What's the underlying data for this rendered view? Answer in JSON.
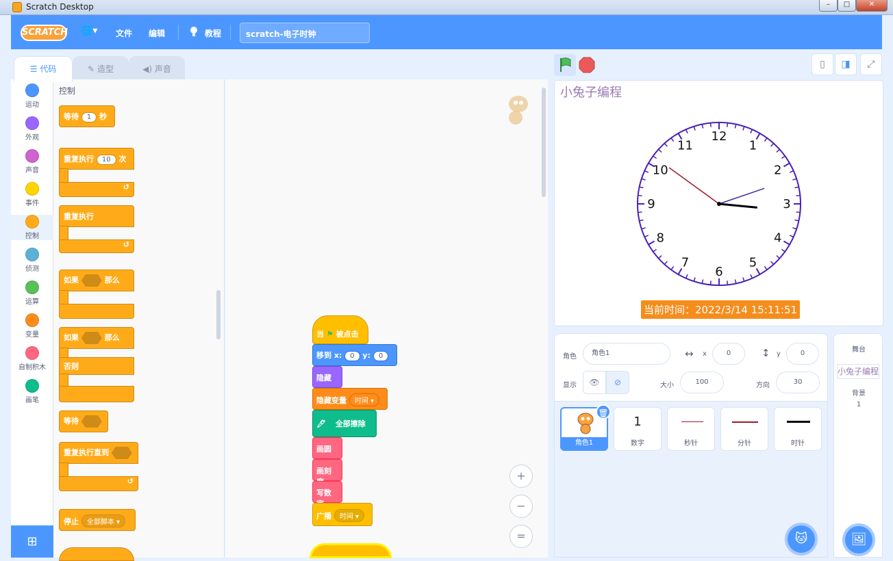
{
  "window": {
    "title": "Scratch Desktop",
    "minimize": "–",
    "maximize": "□",
    "close": "✕"
  },
  "menubar": {
    "logo": "SCRATCH",
    "globe": "🌐▾",
    "file": "文件",
    "edit": "编辑",
    "tutorials": "教程",
    "project_title": "scratch-电子时钟"
  },
  "tabs": {
    "code": "代码",
    "costumes": "造型",
    "sounds": "声音"
  },
  "categories": [
    {
      "label": "运动",
      "color": "#4c97ff"
    },
    {
      "label": "外观",
      "color": "#9966ff"
    },
    {
      "label": "声音",
      "color": "#cf63cf"
    },
    {
      "label": "事件",
      "color": "#ffd500"
    },
    {
      "label": "控制",
      "color": "#ffab19"
    },
    {
      "label": "侦测",
      "color": "#5cb1d6"
    },
    {
      "label": "运算",
      "color": "#59c059"
    },
    {
      "label": "变量",
      "color": "#ff8c1a"
    },
    {
      "label": "自制积木",
      "color": "#ff6680"
    },
    {
      "label": "画笔",
      "color": "#0fbd8c"
    }
  ],
  "palette": {
    "heading": "控制",
    "wait": "等待",
    "wait_value": "1",
    "wait_unit": "秒",
    "repeat": "重复执行",
    "repeat_value": "10",
    "repeat_unit": "次",
    "forever": "重复执行",
    "if": "如果",
    "then": "那么",
    "if2": "如果",
    "then2": "那么",
    "else": "否则",
    "wait_until": "等待",
    "repeat_until": "重复执行直到",
    "stop": "停止",
    "stop_option": "全部脚本 ▾"
  },
  "script": {
    "hat": "当",
    "hat_suffix": "被点击",
    "goto": "移到 x:",
    "goto_x": "0",
    "goto_y_label": "y:",
    "goto_y": "0",
    "hide": "隐藏",
    "hide_var": "隐藏变量",
    "hide_var_option": "时间 ▾",
    "pen_clear": "全部擦除",
    "draw_circle": "画圆",
    "draw_ticks": "画刻度",
    "write_numbers": "写数字",
    "broadcast": "广播",
    "broadcast_option": "时间 ▾"
  },
  "zoom": {
    "in": "+",
    "out": "−",
    "reset": "="
  },
  "stage": {
    "monitor_label": "小兔子编程",
    "time_display": "当前时间：2022/3/14 15:11:51",
    "clock_numbers": [
      "12",
      "1",
      "2",
      "3",
      "4",
      "5",
      "6",
      "7",
      "8",
      "9",
      "10",
      "11"
    ],
    "time": {
      "hour": 15,
      "minute": 11,
      "second": 51
    },
    "colors": {
      "face_ring": "#4a1fb8",
      "hour_hand": "#000000",
      "minute_hand": "#3d2aa8",
      "second_hand": "#a0182a"
    }
  },
  "sprite_info": {
    "sprite_label": "角色",
    "sprite_name": "角色1",
    "x_label": "x",
    "x_value": "0",
    "y_label": "y",
    "y_value": "0",
    "show_label": "显示",
    "size_label": "大小",
    "size_value": "100",
    "direction_label": "方向",
    "direction_value": "30"
  },
  "sprites": [
    {
      "name": "角色1",
      "selected": true
    },
    {
      "name": "数字",
      "glyph": "1"
    },
    {
      "name": "秒针"
    },
    {
      "name": "分针"
    },
    {
      "name": "时针"
    }
  ],
  "stage_panel": {
    "title": "舞台",
    "thumb_label": "小兔子编程",
    "backdrops_label": "背景",
    "backdrops_count": "1"
  }
}
